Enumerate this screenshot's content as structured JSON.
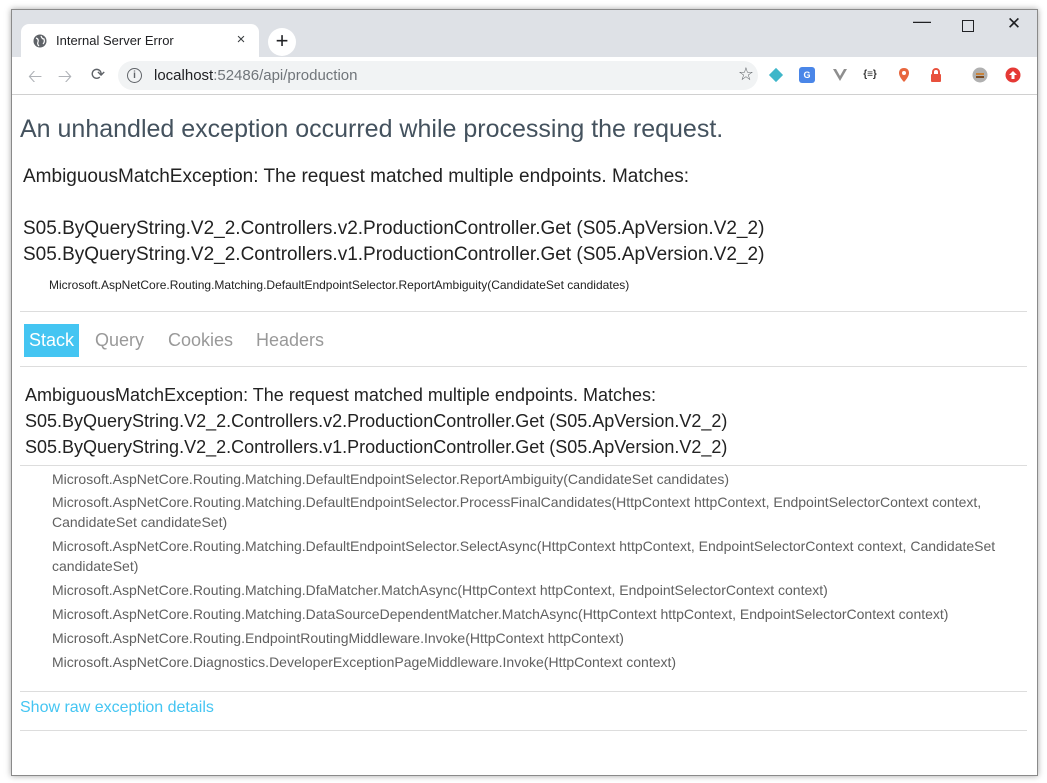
{
  "browser": {
    "tab_title": "Internal Server Error",
    "tab_close_glyph": "×",
    "newtab_glyph": "+",
    "url_host": "localhost",
    "url_rest": ":52486/api/production",
    "icons": {
      "tab_favicon": "globe-icon",
      "back": "back-arrow-icon",
      "forward": "forward-arrow-icon",
      "reload": "reload-icon",
      "site_info": "info-icon",
      "bookmark": "star-icon"
    }
  },
  "page": {
    "heading": "An unhandled exception occurred while processing the request.",
    "error_title": "AmbiguousMatchException: The request matched multiple endpoints. Matches:",
    "matches": [
      "S05.ByQueryString.V2_2.Controllers.v2.ProductionController.Get (S05.ApVersion.V2_2)",
      "S05.ByQueryString.V2_2.Controllers.v1.ProductionController.Get (S05.ApVersion.V2_2)"
    ],
    "location": "Microsoft.AspNetCore.Routing.Matching.DefaultEndpointSelector.ReportAmbiguity(CandidateSet candidates)",
    "tabs": [
      {
        "label": "Stack",
        "active": true
      },
      {
        "label": "Query",
        "active": false
      },
      {
        "label": "Cookies",
        "active": false
      },
      {
        "label": "Headers",
        "active": false
      }
    ],
    "stack": {
      "header_lines": [
        "AmbiguousMatchException: The request matched multiple endpoints. Matches:",
        "S05.ByQueryString.V2_2.Controllers.v2.ProductionController.Get (S05.ApVersion.V2_2)",
        "S05.ByQueryString.V2_2.Controllers.v1.ProductionController.Get (S05.ApVersion.V2_2)"
      ],
      "frames": [
        "Microsoft.AspNetCore.Routing.Matching.DefaultEndpointSelector.ReportAmbiguity(CandidateSet candidates)",
        "Microsoft.AspNetCore.Routing.Matching.DefaultEndpointSelector.ProcessFinalCandidates(HttpContext httpContext, EndpointSelectorContext context, CandidateSet candidateSet)",
        "Microsoft.AspNetCore.Routing.Matching.DefaultEndpointSelector.SelectAsync(HttpContext httpContext, EndpointSelectorContext context, CandidateSet candidateSet)",
        "Microsoft.AspNetCore.Routing.Matching.DfaMatcher.MatchAsync(HttpContext httpContext, EndpointSelectorContext context)",
        "Microsoft.AspNetCore.Routing.Matching.DataSourceDependentMatcher.MatchAsync(HttpContext httpContext, EndpointSelectorContext context)",
        "Microsoft.AspNetCore.Routing.EndpointRoutingMiddleware.Invoke(HttpContext httpContext)",
        "Microsoft.AspNetCore.Diagnostics.DeveloperExceptionPageMiddleware.Invoke(HttpContext context)"
      ]
    },
    "raw_link": "Show raw exception details"
  },
  "colors": {
    "accent": "#44c5f2",
    "heading": "#44525e"
  }
}
